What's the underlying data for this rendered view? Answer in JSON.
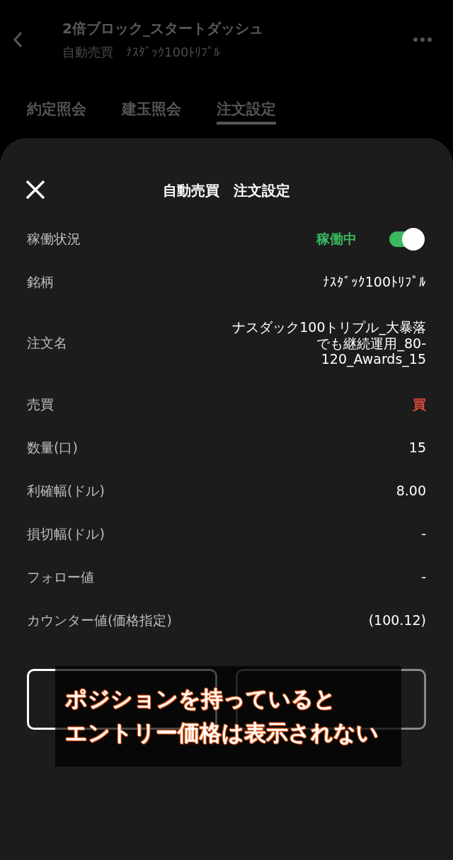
{
  "header": {
    "title": "2倍ブロック_スタートダッシュ",
    "subtitle": "自動売買　ﾅｽﾀﾞｯｸ100ﾄﾘﾌﾟﾙ"
  },
  "tabs": [
    {
      "label": "約定照会",
      "selected": false
    },
    {
      "label": "建玉照会",
      "selected": false
    },
    {
      "label": "注文設定",
      "selected": true
    }
  ],
  "sheet": {
    "title": "自動売買　注文設定",
    "rows": [
      {
        "kind": "status",
        "label": "稼働状況",
        "value": "稼働中",
        "on": true
      },
      {
        "kind": "text",
        "label": "銘柄",
        "value": "ﾅｽﾀﾞｯｸ100ﾄﾘﾌﾟﾙ"
      },
      {
        "kind": "text",
        "label": "注文名",
        "value": "ナスダック100トリプル_大暴落でも継続運用_80-120_Awards_15"
      },
      {
        "kind": "side",
        "label": "売買",
        "value": "買"
      },
      {
        "kind": "text",
        "label": "数量(口)",
        "value": "15"
      },
      {
        "kind": "text",
        "label": "利確幅(ドル)",
        "value": "8.00"
      },
      {
        "kind": "text",
        "label": "損切幅(ドル)",
        "value": "-"
      },
      {
        "kind": "text",
        "label": "フォロー値",
        "value": "-"
      },
      {
        "kind": "text",
        "label": "カウンター値(価格指定)",
        "value": "(100.12)"
      }
    ],
    "buttons": [
      {
        "primary": true
      },
      {
        "primary": false
      }
    ]
  },
  "annotation": {
    "lines": [
      "ポジションを持っていると",
      "エントリー価格は表示されない"
    ]
  }
}
